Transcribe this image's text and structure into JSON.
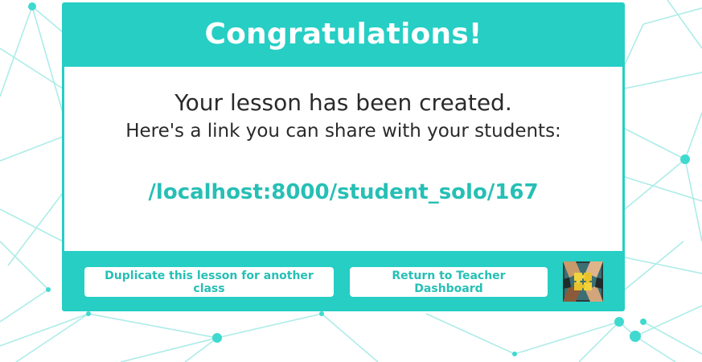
{
  "header": {
    "title": "Congratulations!"
  },
  "body": {
    "lesson_created": "Your lesson has been created.",
    "share_text": "Here's a link you can share with your students:",
    "share_link": "/localhost:8000/student_solo/167"
  },
  "footer": {
    "duplicate_label": "Duplicate this lesson for another class",
    "dashboard_label": "Return to Teacher Dashboard",
    "logo_icon": "puzzle-hands-icon"
  },
  "colors": {
    "accent": "#26cec4",
    "link": "#26bfb5",
    "text": "#2a2a2a",
    "network": "#7fe3dd"
  }
}
